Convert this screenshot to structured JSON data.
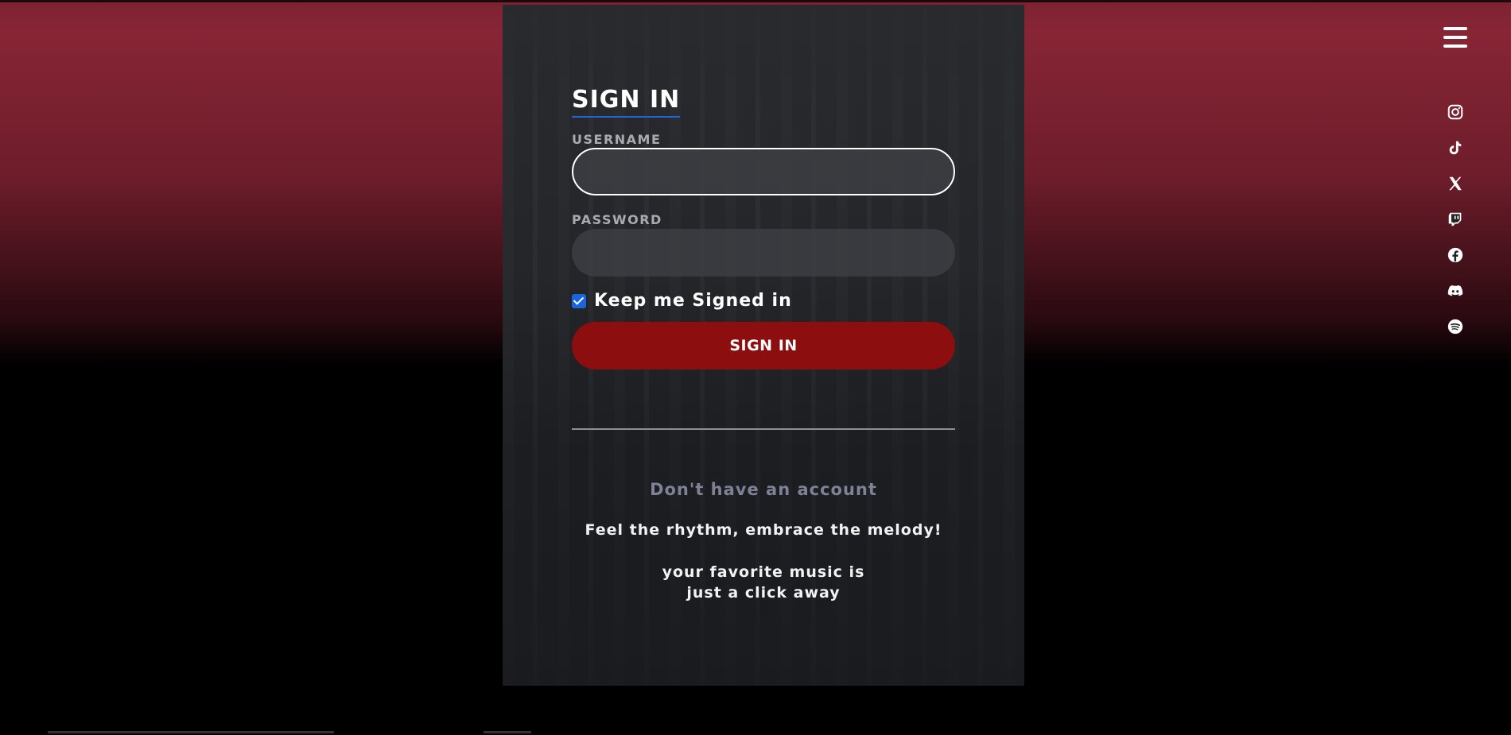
{
  "form": {
    "title": "SIGN IN",
    "username_label": "USERNAME",
    "password_label": "PASSWORD",
    "remember_label": "Keep me Signed in",
    "remember_checked": true,
    "submit_label": "SIGN IN"
  },
  "footer": {
    "no_account": "Don't have an account",
    "tagline_line1": "Feel the rhythm, embrace the melody!",
    "tagline_line2": "your favorite music is",
    "tagline_line3": "just a click away"
  },
  "nav": {
    "menu_icon": "hamburger-menu-icon"
  },
  "social": [
    "instagram-icon",
    "tiktok-icon",
    "x-icon",
    "twitch-icon",
    "facebook-icon",
    "discord-icon",
    "spotify-icon"
  ],
  "colors": {
    "accent_red": "#8c0e0e",
    "accent_blue": "#2166d1",
    "background_top": "#872535",
    "background_bottom": "#000000"
  }
}
